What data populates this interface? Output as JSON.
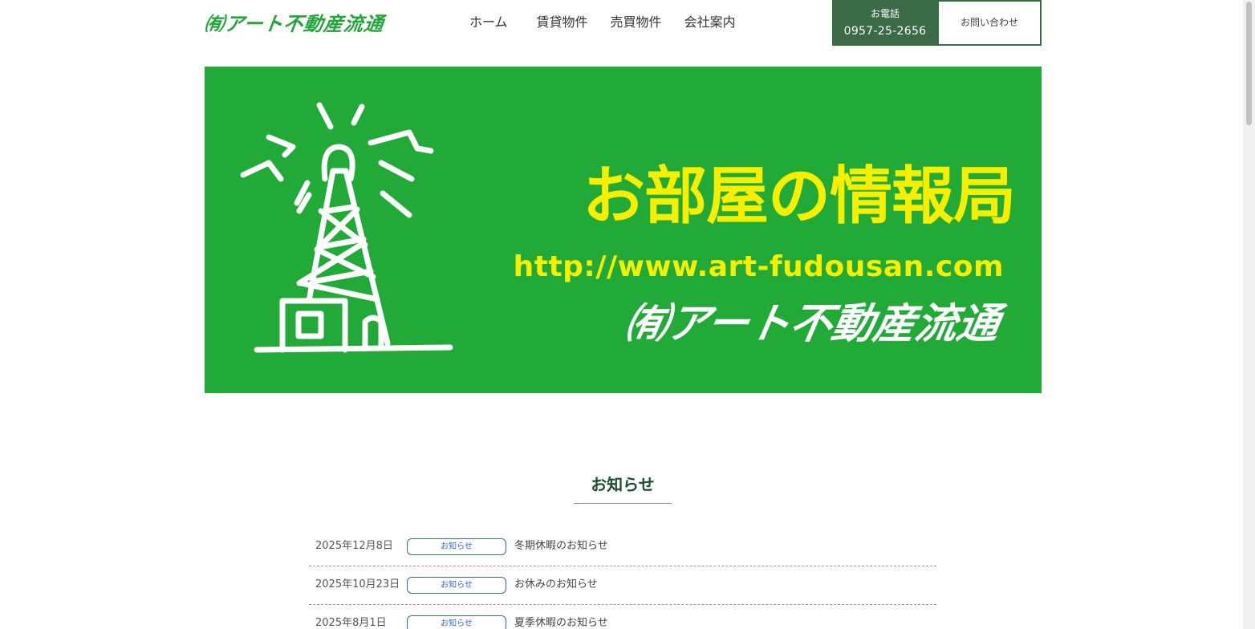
{
  "header": {
    "logo_text": "㈲アート不動産流通",
    "nav": [
      "ホーム",
      "賃貸物件",
      "売買物件",
      "会社案内"
    ],
    "phone_label": "お電話",
    "phone_number": "0957-25-2656",
    "contact_label": "お問い合わせ"
  },
  "hero": {
    "title": "お部屋の情報局",
    "url": "http://www.art-fudousan.com",
    "company": "㈲アート不動産流通",
    "background_color": "#21aa38",
    "title_color": "#f7ef00"
  },
  "news": {
    "heading": "お知らせ",
    "items": [
      {
        "date": "2025年12月8日",
        "category": "お知らせ",
        "title": "冬期休暇のお知らせ"
      },
      {
        "date": "2025年10月23日",
        "category": "お知らせ",
        "title": "お休みのお知らせ"
      },
      {
        "date": "2025年8月1日",
        "category": "お知らせ",
        "title": "夏季休暇のお知らせ"
      }
    ]
  },
  "colors": {
    "accent": "#3b6b46",
    "brand_green": "#21a638",
    "badge": "#3366cc"
  }
}
